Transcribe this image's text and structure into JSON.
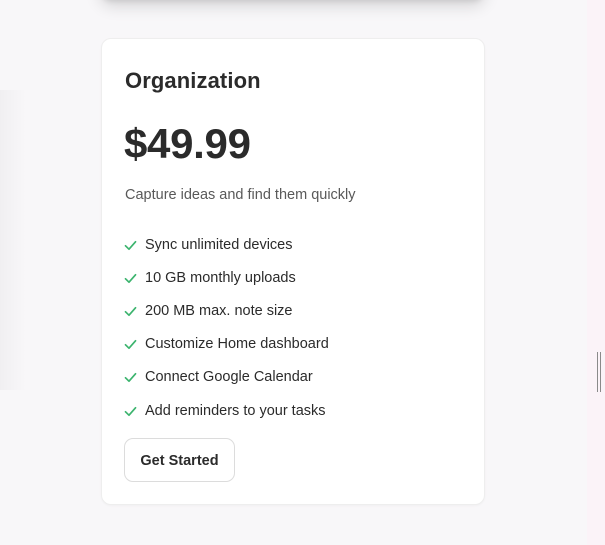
{
  "colors": {
    "check": "#3cb46e",
    "text": "#2b2b2b",
    "muted": "#595959",
    "card_bg": "#ffffff",
    "page_bg": "#f8f7f9"
  },
  "plan": {
    "name": "Organization",
    "price": "$49.99",
    "description": "Capture ideas and find them quickly",
    "features": [
      {
        "icon": "check-icon",
        "label": "Sync unlimited devices"
      },
      {
        "icon": "check-icon",
        "label": "10 GB monthly uploads"
      },
      {
        "icon": "check-icon",
        "label": "200 MB max. note size"
      },
      {
        "icon": "check-icon",
        "label": "Customize Home dashboard"
      },
      {
        "icon": "check-icon",
        "label": "Connect Google Calendar"
      },
      {
        "icon": "check-icon",
        "label": "Add reminders to your tasks"
      }
    ],
    "cta_label": "Get Started"
  }
}
